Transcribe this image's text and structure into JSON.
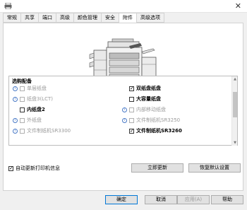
{
  "tabs": [
    "常规",
    "共享",
    "端口",
    "高级",
    "颜色管理",
    "安全",
    "附件",
    "高级选项"
  ],
  "active_tab": "附件",
  "options_group": {
    "title": "选购配备",
    "left": [
      {
        "label": "单层纸盘",
        "info": true,
        "checked": false,
        "disabled": true
      },
      {
        "label": "纸盘3(LCT)",
        "info": true,
        "checked": false,
        "disabled": true
      },
      {
        "label": "内纸盘2",
        "info": false,
        "checked": false,
        "disabled": false,
        "bold": true
      },
      {
        "label": "外纸盘",
        "info": true,
        "checked": false,
        "disabled": true
      },
      {
        "label": "文件制纸机SR3300",
        "info": true,
        "checked": false,
        "disabled": true
      }
    ],
    "right": [
      {
        "label": "双纸盘纸盘",
        "info": false,
        "checked": true,
        "disabled": false,
        "bold": true
      },
      {
        "label": "大容量纸盘",
        "info": false,
        "checked": false,
        "disabled": false,
        "bold": true
      },
      {
        "label": "内部移动纸盘",
        "info": true,
        "checked": false,
        "disabled": true
      },
      {
        "label": "文件制纸机SR3250",
        "info": true,
        "checked": false,
        "disabled": true
      },
      {
        "label": "文件制纸机SR3260",
        "info": false,
        "checked": true,
        "disabled": false,
        "bold": true
      }
    ]
  },
  "auto_update": {
    "label": "自动更新打印机信息",
    "checked": true
  },
  "buttons": {
    "update_now": "立即更新",
    "restore_defaults": "恢复默认设置",
    "ok": "确定",
    "cancel": "取消",
    "apply": "应用(A)",
    "help": "帮助"
  }
}
